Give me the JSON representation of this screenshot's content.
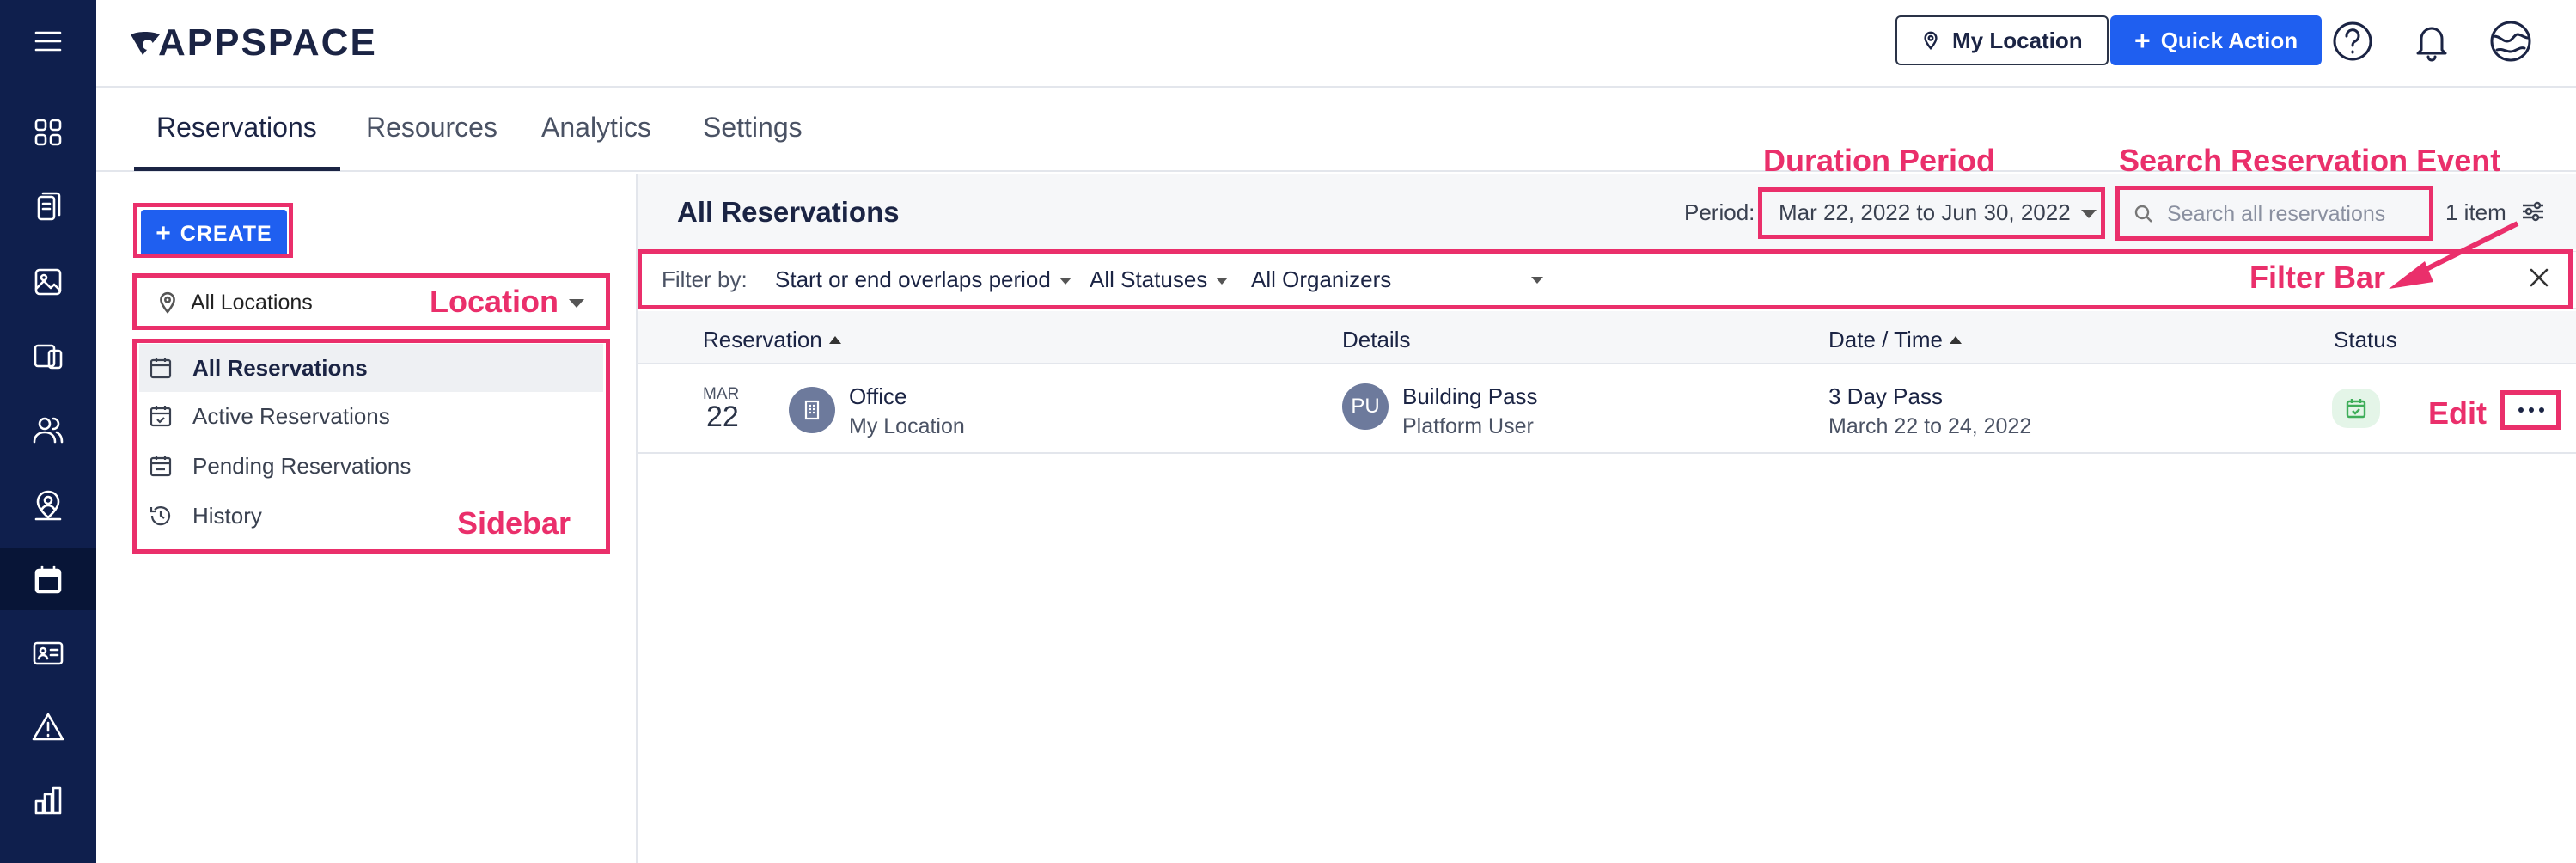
{
  "app": {
    "logo_text": "APPSPACE"
  },
  "rail": {
    "items": [
      {
        "icon": "menu-icon"
      },
      {
        "icon": "dashboard-icon"
      },
      {
        "icon": "content-icon"
      },
      {
        "icon": "image-icon"
      },
      {
        "icon": "devices-icon"
      },
      {
        "icon": "users-icon"
      },
      {
        "icon": "location-badge-icon"
      },
      {
        "icon": "calendar-icon",
        "active": true
      },
      {
        "icon": "id-card-icon"
      },
      {
        "icon": "alert-icon"
      },
      {
        "icon": "analytics-icon"
      }
    ]
  },
  "header": {
    "my_location": "My Location",
    "quick_action": "Quick Action"
  },
  "tabs": [
    "Reservations",
    "Resources",
    "Analytics",
    "Settings"
  ],
  "sidebar": {
    "create": "CREATE",
    "location": "All Locations",
    "items": [
      {
        "label": "All Reservations",
        "active": true
      },
      {
        "label": "Active Reservations"
      },
      {
        "label": "Pending Reservations"
      },
      {
        "label": "History"
      }
    ]
  },
  "main": {
    "title": "All Reservations",
    "period_label": "Period:",
    "period_value": "Mar 22, 2022 to Jun 30, 2022",
    "search_placeholder": "Search all reservations",
    "count": "1 item"
  },
  "filters": {
    "label": "Filter by:",
    "overlap": "Start or end overlaps period",
    "statuses": "All Statuses",
    "organizers": "All Organizers"
  },
  "table": {
    "headers": [
      "Reservation",
      "Details",
      "Date / Time",
      "Status"
    ],
    "rows": [
      {
        "month": "MAR",
        "day": "22",
        "resource": "Office",
        "location": "My Location",
        "initials": "PU",
        "detail_title": "Building Pass",
        "detail_sub": "Platform User",
        "when_title": "3 Day Pass",
        "when_sub": "March 22 to 24, 2022"
      }
    ]
  },
  "annotations": {
    "duration": "Duration Period",
    "search": "Search Reservation Event",
    "location": "Location",
    "filter_bar": "Filter Bar",
    "sidebar": "Sidebar",
    "edit": "Edit"
  },
  "colors": {
    "accent": "#1f5ff0",
    "rail": "#0f1f4d",
    "annotation": "#ea2f6b"
  }
}
